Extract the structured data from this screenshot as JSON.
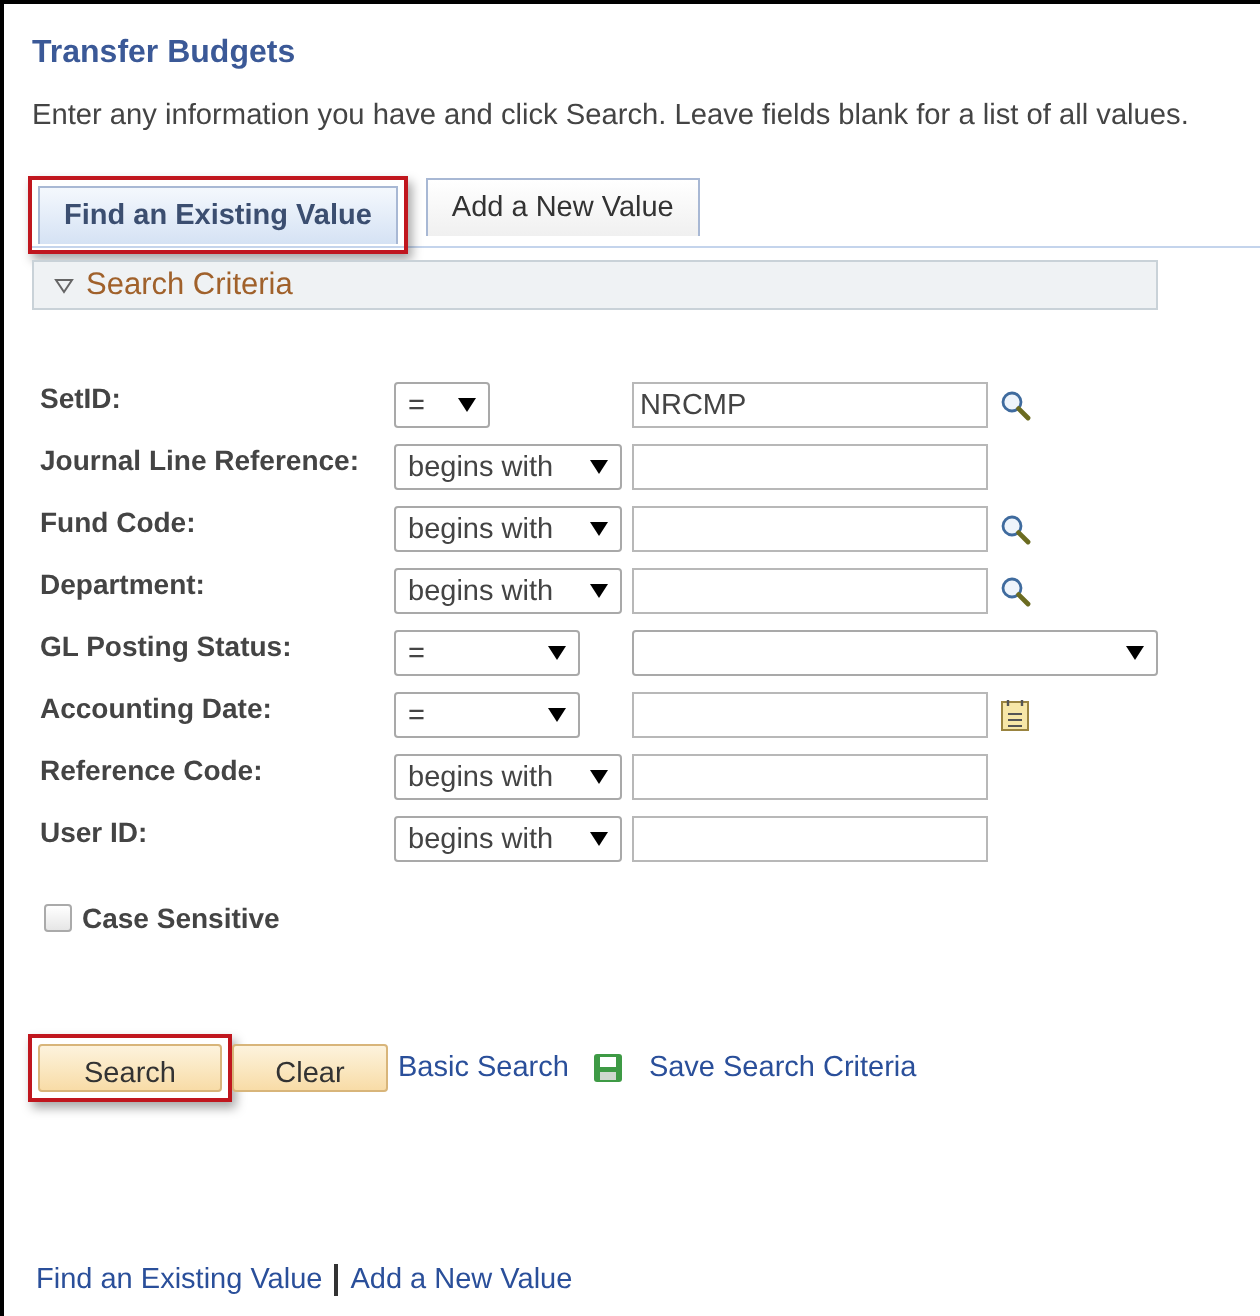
{
  "page": {
    "title": "Transfer Budgets",
    "instructions": "Enter any information you have and click Search. Leave fields blank for a list of all values."
  },
  "tabs": [
    {
      "label": "Find an Existing Value",
      "selected": true,
      "highlighted": true
    },
    {
      "label": "Add a New Value",
      "selected": false,
      "highlighted": false
    }
  ],
  "section": {
    "title": "Search Criteria",
    "expanded": true
  },
  "criteria": [
    {
      "kind": "key",
      "label": "SetID:",
      "operator": "=",
      "value": "NRCMP"
    },
    {
      "kind": "text",
      "label": "Journal Line Reference:",
      "operator": "begins with"
    },
    {
      "kind": "lookup",
      "label": "Fund Code:",
      "operator": "begins with"
    },
    {
      "kind": "lookup",
      "label": "Department:",
      "operator": "begins with"
    },
    {
      "kind": "choice",
      "label": "GL Posting Status:",
      "operator": "="
    },
    {
      "kind": "date",
      "label": "Accounting Date:",
      "operator": "="
    },
    {
      "kind": "text",
      "label": "Reference Code:",
      "operator": "begins with"
    },
    {
      "kind": "text",
      "label": "User ID:",
      "operator": "begins with"
    }
  ],
  "case_sensitive": {
    "label": "Case Sensitive",
    "checked": false
  },
  "buttons": [
    {
      "label": "Search",
      "highlighted": true
    },
    {
      "label": "Clear",
      "highlighted": false
    }
  ],
  "links": [
    {
      "kind": "plain",
      "label": "Basic Search"
    },
    {
      "kind": "save",
      "label": "Save Search Criteria"
    }
  ],
  "footer_links": [
    "Find an Existing Value",
    "Add a New Value"
  ]
}
